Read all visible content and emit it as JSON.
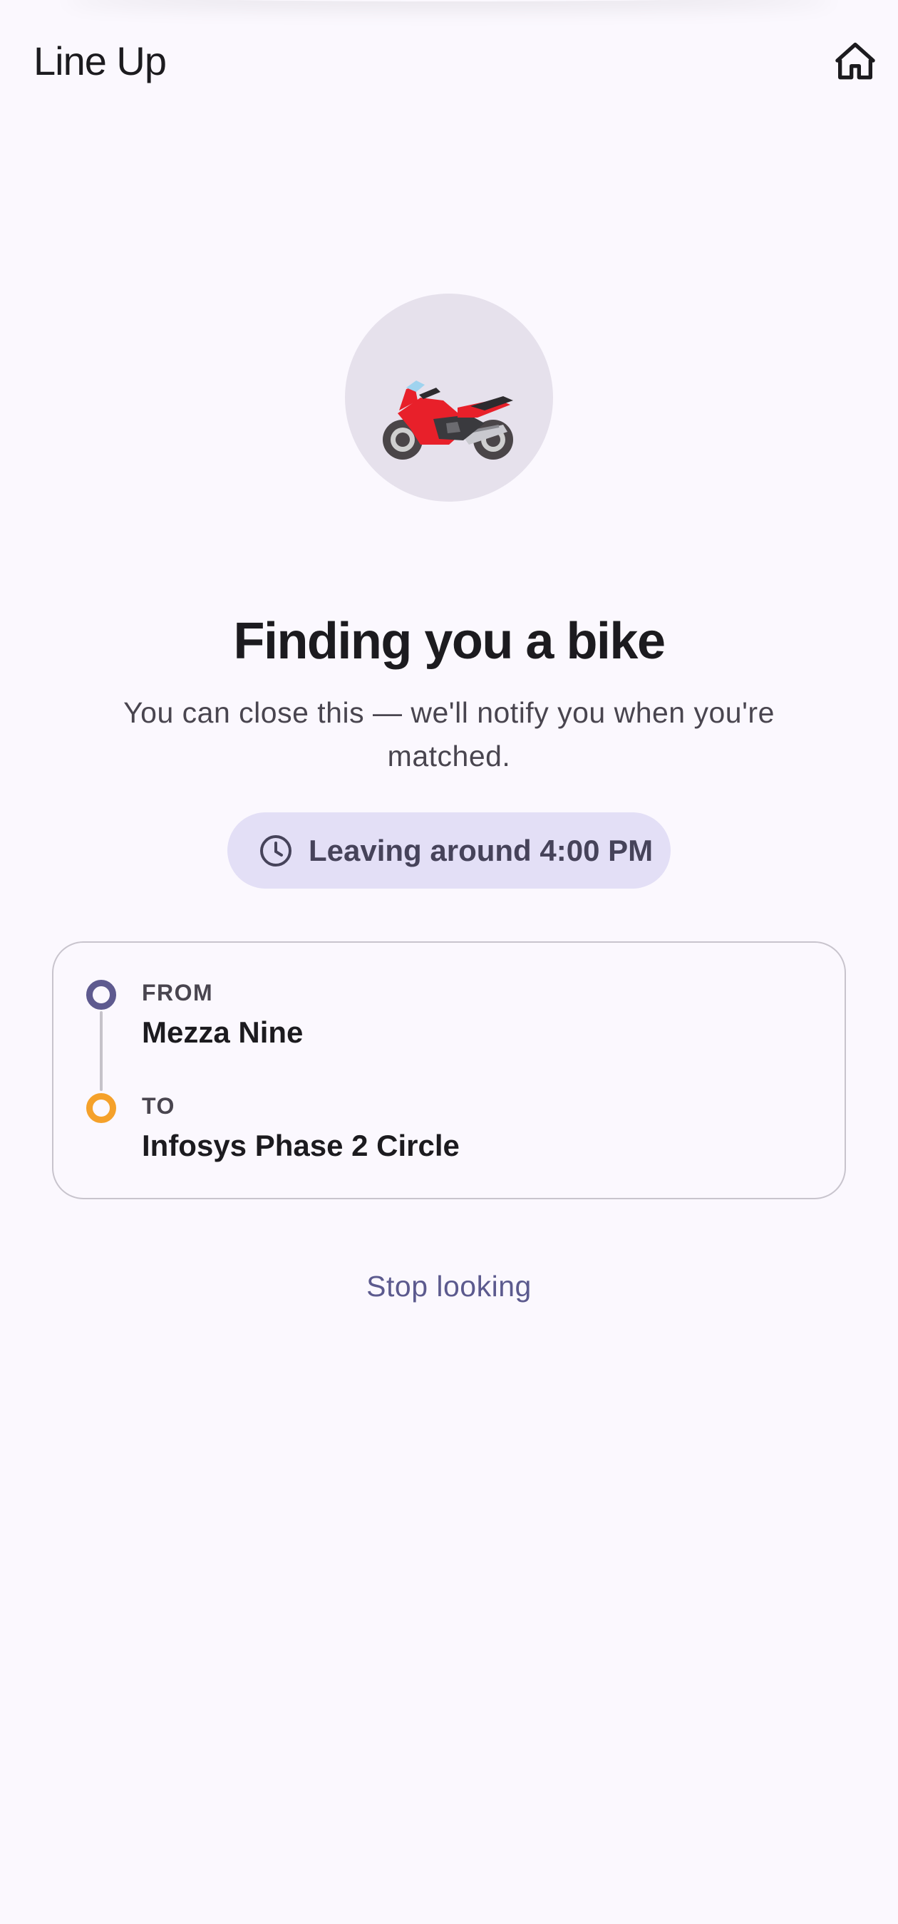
{
  "header": {
    "title": "Line Up",
    "home_icon": "home-icon"
  },
  "status": {
    "illustration_icon": "motorcycle-icon",
    "heading": "Finding you a bike",
    "subtext": "You can close this — we'll notify you when you're matched."
  },
  "time_chip": {
    "icon": "clock-icon",
    "label": "Leaving around 4:00 PM"
  },
  "route": {
    "from_label": "FROM",
    "from_value": "Mezza Nine",
    "to_label": "TO",
    "to_value": "Infosys Phase 2 Circle"
  },
  "actions": {
    "stop_label": "Stop looking"
  },
  "colors": {
    "background": "#fbf8fe",
    "chip": "#e3dff6",
    "from_dot": "#5e5a8f",
    "to_dot": "#f5a12a",
    "accent_text": "#5c5a8e"
  }
}
